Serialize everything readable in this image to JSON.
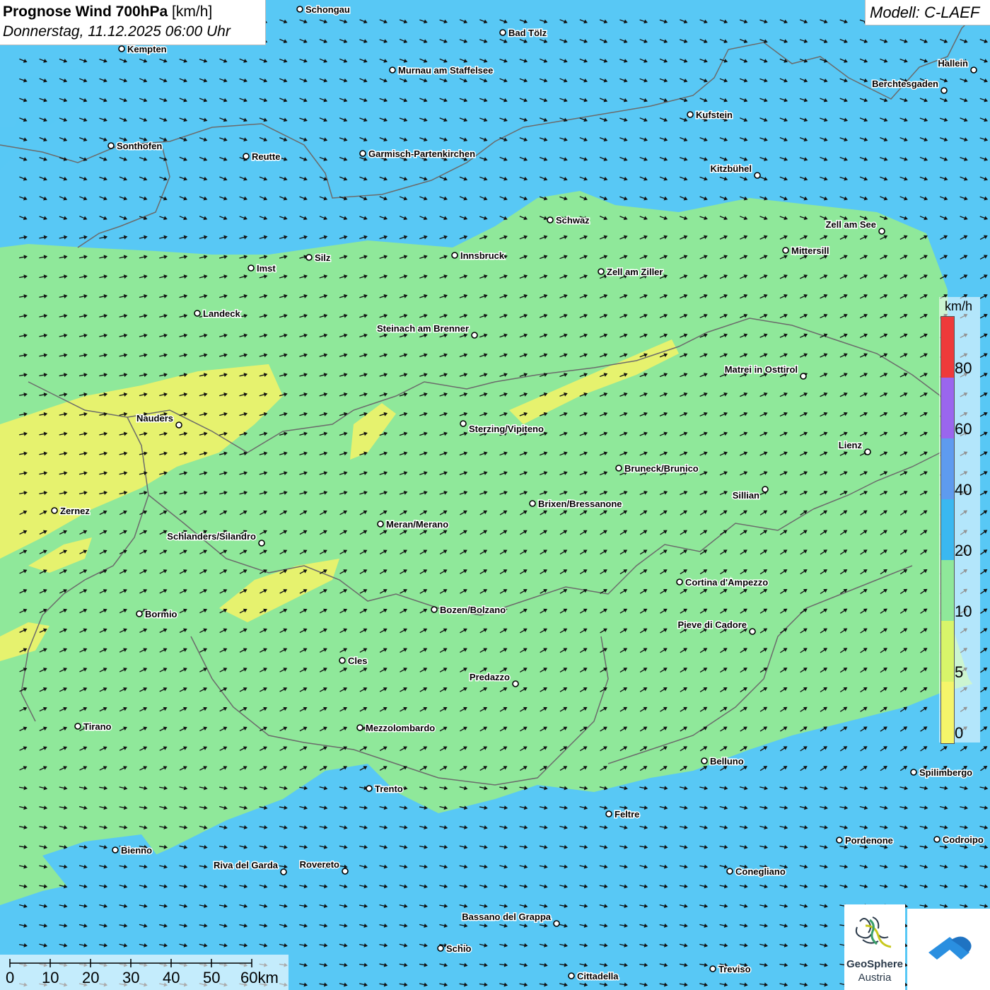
{
  "header": {
    "title": "Prognose Wind 700hPa",
    "unit": "[km/h]",
    "datetime": "Donnerstag, 11.12.2025 06:00 Uhr"
  },
  "model": {
    "label": "Modell: C-LAEF"
  },
  "legend": {
    "unit": "km/h",
    "classes": [
      {
        "label": "80",
        "color": "#ee3a3a"
      },
      {
        "label": "60",
        "color": "#9a66ee"
      },
      {
        "label": "40",
        "color": "#5e9bef"
      },
      {
        "label": "20",
        "color": "#3ab8f0"
      },
      {
        "label": "10",
        "color": "#8fe89a"
      },
      {
        "label": "5",
        "color": "#d8f56a"
      },
      {
        "label": "0",
        "color": "#f5f56a"
      }
    ]
  },
  "scale_bar": {
    "labels": [
      "0",
      "10",
      "20",
      "30",
      "40",
      "50",
      "60km"
    ]
  },
  "logo": {
    "name": "GeoSphere",
    "sub": "Austria"
  },
  "colors": {
    "wind_low": "#8fe89a",
    "wind_mid": "#58c8f5",
    "wind_calm": "#e6f26e",
    "border": "#6b6b6b"
  },
  "cities": [
    {
      "name": "Schongau"
    },
    {
      "name": "Bad Tölz"
    },
    {
      "name": "Kempten"
    },
    {
      "name": "Murnau am Staffelsee"
    },
    {
      "name": "Hallein"
    },
    {
      "name": "Berchtesgaden"
    },
    {
      "name": "Kufstein"
    },
    {
      "name": "Sonthofen"
    },
    {
      "name": "Reutte"
    },
    {
      "name": "Garmisch-Partenkirchen"
    },
    {
      "name": "Kitzbühel"
    },
    {
      "name": "Schwaz"
    },
    {
      "name": "Zell am See"
    },
    {
      "name": "Mittersill"
    },
    {
      "name": "Innsbruck"
    },
    {
      "name": "Silz"
    },
    {
      "name": "Imst"
    },
    {
      "name": "Zell am Ziller"
    },
    {
      "name": "Landeck"
    },
    {
      "name": "Steinach am Brenner"
    },
    {
      "name": "Matrei in Osttirol"
    },
    {
      "name": "Nauders"
    },
    {
      "name": "Sterzing/Vipiteno"
    },
    {
      "name": "Lienz"
    },
    {
      "name": "Bruneck/Brunico"
    },
    {
      "name": "Sillian"
    },
    {
      "name": "Zernez"
    },
    {
      "name": "Brixen/Bressanone"
    },
    {
      "name": "Meran/Merano"
    },
    {
      "name": "Schlanders/Silandro"
    },
    {
      "name": "Cortina d'Ampezzo"
    },
    {
      "name": "Bozen/Bolzano"
    },
    {
      "name": "Bormio"
    },
    {
      "name": "Pieve di Cadore"
    },
    {
      "name": "Cles"
    },
    {
      "name": "Predazzo"
    },
    {
      "name": "Tirano"
    },
    {
      "name": "Mezzolombardo"
    },
    {
      "name": "Belluno"
    },
    {
      "name": "Spilimbergo"
    },
    {
      "name": "Trento"
    },
    {
      "name": "Feltre"
    },
    {
      "name": "Pordenone"
    },
    {
      "name": "Codroipo"
    },
    {
      "name": "Bienno"
    },
    {
      "name": "Riva del Garda"
    },
    {
      "name": "Rovereto"
    },
    {
      "name": "Conegliano"
    },
    {
      "name": "Bassano del Grappa"
    },
    {
      "name": "Schio"
    },
    {
      "name": "Treviso"
    },
    {
      "name": "Cittadella"
    }
  ]
}
